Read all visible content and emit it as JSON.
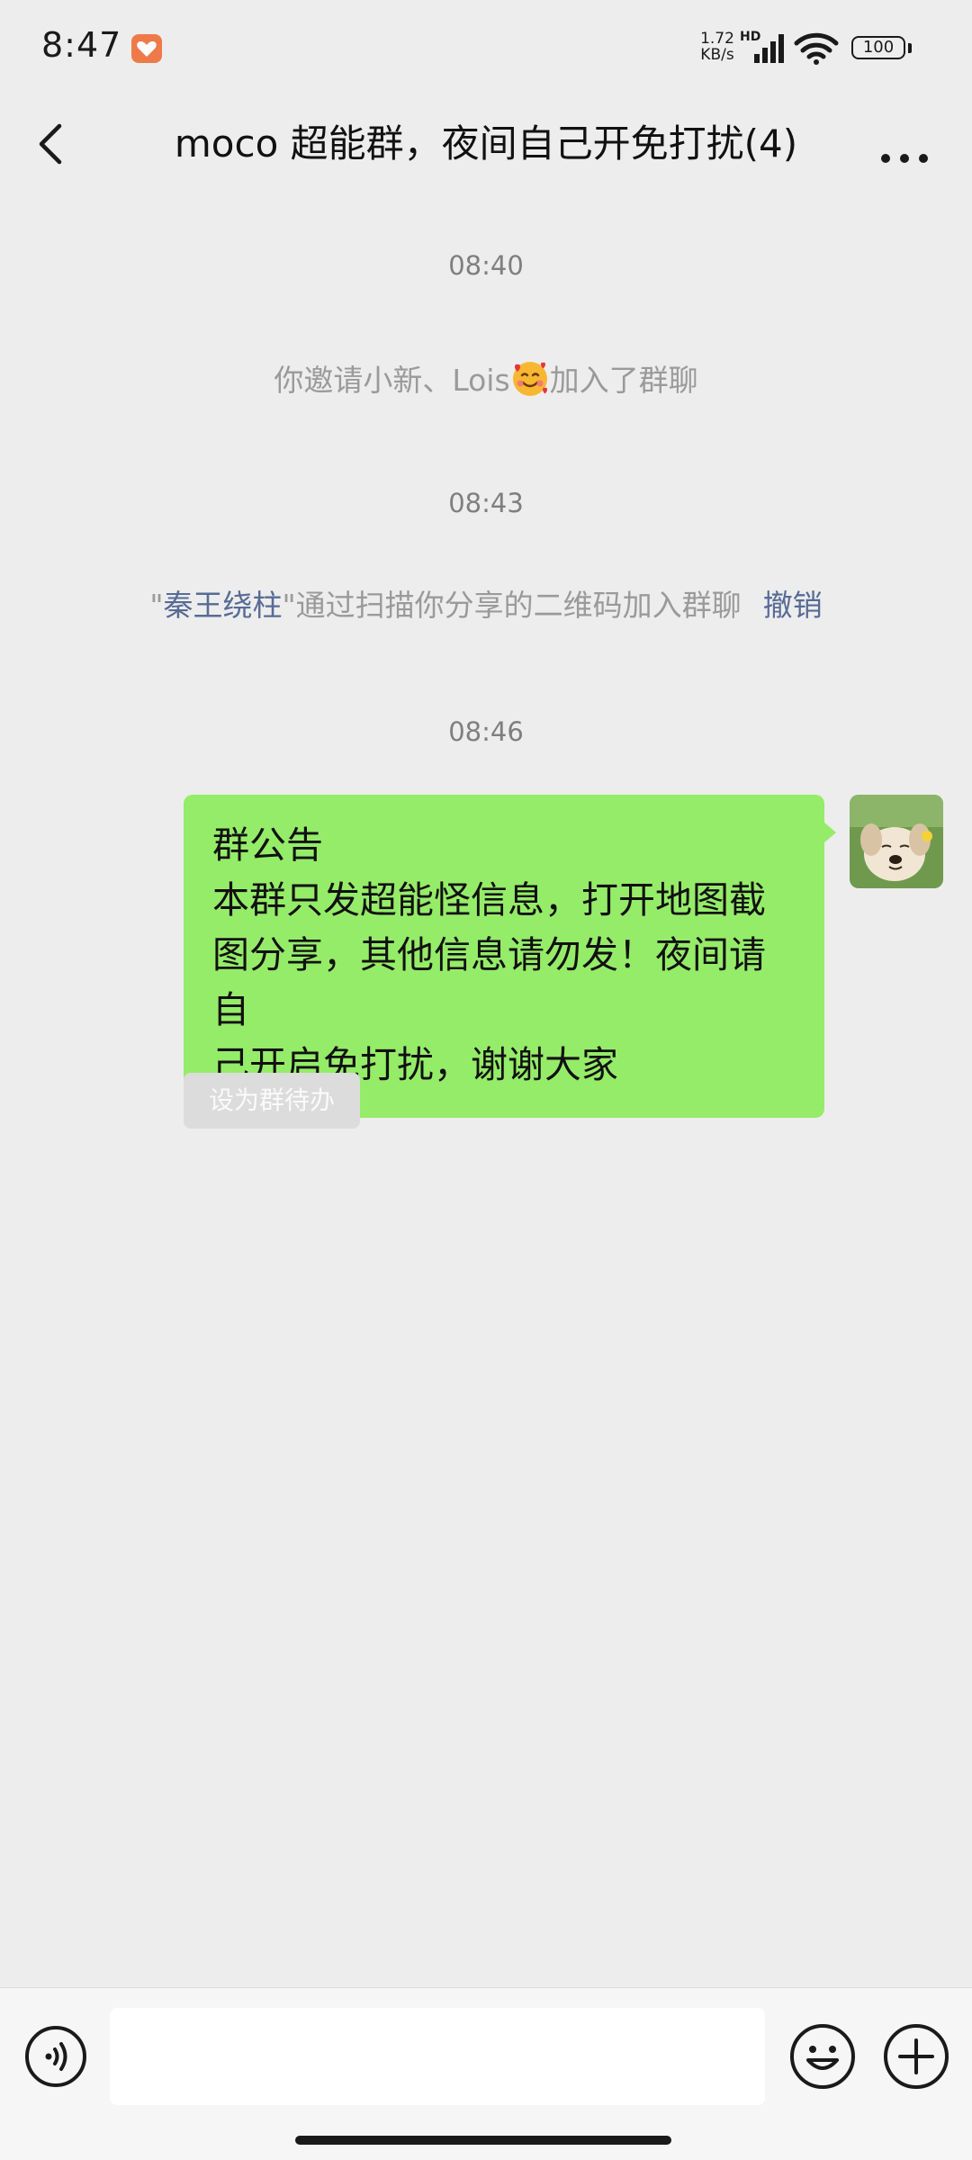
{
  "status_bar": {
    "time": "8:47",
    "net_speed_value": "1.72",
    "net_speed_unit": "KB/s",
    "hd": "HD",
    "battery": "100",
    "icons": [
      "heart-notification-icon",
      "signal-icon",
      "wifi-icon",
      "battery-icon"
    ]
  },
  "nav": {
    "title": "moco 超能群，夜间自己开免打扰(4)",
    "icons": [
      "back-arrow-icon",
      "more-icon"
    ]
  },
  "chat": {
    "time_1": "08:40",
    "invite_pre": "你邀请小新、Lois",
    "invite_post": "加入了群聊",
    "time_2": "08:43",
    "join_open_quote": "\"",
    "join_name": "秦王绕柱",
    "join_rest": "\"通过扫描你分享的二维码加入群聊",
    "revoke": "撤销",
    "time_3": "08:46",
    "message_lines": [
      "群公告",
      "本群只发超能怪信息，打开地图截",
      "图分享，其他信息请勿发！夜间请自",
      "己开启免打扰，谢谢大家"
    ],
    "todo_chip": "设为群待办"
  },
  "input_bar": {
    "placeholder": "",
    "icons": [
      "voice-icon",
      "emoji-icon",
      "plus-icon"
    ]
  },
  "colors": {
    "background": "#ededed",
    "bubble": "#95ec69",
    "link": "#576b95",
    "system_text": "#9a9a9a"
  }
}
